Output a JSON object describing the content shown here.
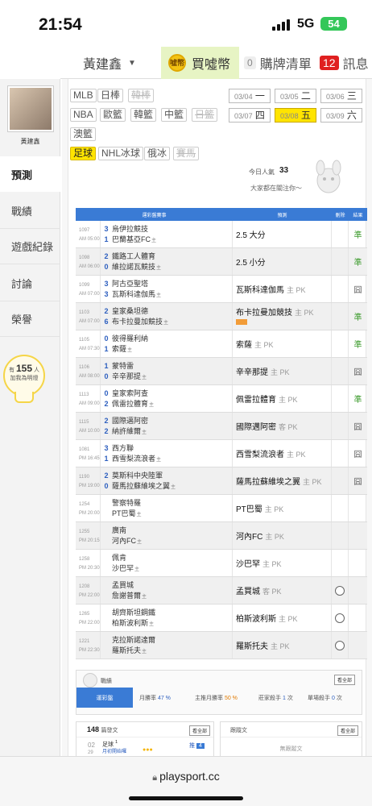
{
  "status_bar": {
    "time": "21:54",
    "network": "5G",
    "battery": "54"
  },
  "top_nav": {
    "user": "黃建鑫",
    "buy_label": "買噓幣",
    "coin_text": "噓幣",
    "bought_count": "0",
    "bought_label": "購牌清單",
    "msg_count": "12",
    "msg_label": "訊息"
  },
  "sidebar": {
    "name": "黃建鑫",
    "items": [
      "預測",
      "戰績",
      "遊戲紀錄",
      "討論",
      "榮譽"
    ],
    "people_count": "155",
    "people_unit": "人",
    "people_text": "加我為明燈",
    "people_prefix": "有"
  },
  "leagues": [
    {
      "label": "MLB",
      "state": "normal"
    },
    {
      "label": "日棒",
      "state": "normal"
    },
    {
      "label": "韓棒",
      "state": "disabled"
    },
    {
      "label": "NBA",
      "state": "normal"
    },
    {
      "label": "歐籃",
      "state": "normal"
    },
    {
      "label": "韓籃",
      "state": "normal"
    },
    {
      "label": "中籃",
      "state": "normal"
    },
    {
      "label": "日籃",
      "state": "disabled"
    },
    {
      "label": "澳籃",
      "state": "normal"
    },
    {
      "label": "足球",
      "state": "selected"
    },
    {
      "label": "NHL冰球",
      "state": "normal"
    },
    {
      "label": "俄冰",
      "state": "normal"
    },
    {
      "label": "賽馬",
      "state": "disabled"
    }
  ],
  "dates": [
    {
      "md": "03/04",
      "wd": "一"
    },
    {
      "md": "03/05",
      "wd": "二"
    },
    {
      "md": "03/06",
      "wd": "三"
    },
    {
      "md": "03/07",
      "wd": "四"
    },
    {
      "md": "03/08",
      "wd": "五",
      "selected": true
    },
    {
      "md": "03/09",
      "wd": "六"
    }
  ],
  "popularity": {
    "label": "今日人氣",
    "value": "33",
    "sub": "大家都在關注你～"
  },
  "table": {
    "headers": [
      "運彩盤賽事",
      "預測",
      "刪除",
      "結果"
    ],
    "rows": [
      {
        "id": "1097",
        "time": "AM 05:00",
        "s1": "3",
        "s2": "1",
        "t1": "烏伊拉競技",
        "t2": "巴蘭基亞FC",
        "t2tag": "主",
        "pred": "2.5 大分",
        "sub": "",
        "del": false,
        "res": "準"
      },
      {
        "id": "1098",
        "time": "AM 06:00",
        "s1": "2",
        "s2": "0",
        "t1": "鐵路工人體育",
        "t2": "維拉諾瓦競技",
        "t2tag": "主",
        "pred": "2.5 小分",
        "sub": "",
        "del": false,
        "res": "準"
      },
      {
        "id": "1099",
        "time": "AM 07:00",
        "s1": "3",
        "s2": "3",
        "t1": "阿古亞聖塔",
        "t2": "瓦斯科達伽馬",
        "t2tag": "主",
        "pred": "瓦斯科達伽馬",
        "sub": "主 PK",
        "del": false,
        "res": "囧"
      },
      {
        "id": "1103",
        "time": "AM 07:00",
        "s1": "2",
        "s2": "6",
        "t1": "皇家桑坦德",
        "t2": "布卡拉曼加競技",
        "t2tag": "主",
        "pred": "布卡拉曼加競技",
        "sub": "主 PK",
        "del": false,
        "res": "準",
        "tag": true
      },
      {
        "id": "1105",
        "time": "AM 07:30",
        "s1": "0",
        "s2": "1",
        "t1": "彼得羅利納",
        "t2": "索薩",
        "t2tag": "主",
        "pred": "索薩",
        "sub": "主 PK",
        "del": false,
        "res": "準"
      },
      {
        "id": "1106",
        "time": "AM 08:00",
        "s1": "1",
        "s2": "0",
        "t1": "蒙特雷",
        "t2": "辛辛那提",
        "t2tag": "主",
        "pred": "辛辛那提",
        "sub": "主 PK",
        "del": false,
        "res": "囧"
      },
      {
        "id": "1113",
        "time": "AM 09:00",
        "s1": "0",
        "s2": "2",
        "t1": "皇家索阿查",
        "t2": "佩雷拉體育",
        "t2tag": "主",
        "pred": "佩雷拉體育",
        "sub": "主 PK",
        "del": false,
        "res": "準"
      },
      {
        "id": "1115",
        "time": "AM 10:00",
        "s1": "2",
        "s2": "2",
        "t1": "國際邁阿密",
        "t2": "納許維爾",
        "t2tag": "主",
        "pred": "國際邁阿密",
        "sub": "客 PK",
        "del": false,
        "res": "囧"
      },
      {
        "id": "1081",
        "time": "PM 16:45",
        "s1": "3",
        "s2": "1",
        "t1": "西方聯",
        "t2": "西雪梨流浪者",
        "t2tag": "主",
        "pred": "西雪梨流浪者",
        "sub": "主 PK",
        "del": false,
        "res": "囧"
      },
      {
        "id": "1190",
        "time": "PM 19:00",
        "s1": "2",
        "s2": "0",
        "t1": "莫斯科中央陸軍",
        "t2": "薩馬拉蘇維埃之翼",
        "t2tag": "主",
        "pred": "薩馬拉蘇維埃之翼",
        "sub": "主 PK",
        "del": false,
        "res": "囧"
      },
      {
        "id": "1254",
        "time": "PM 20:00",
        "s1": "",
        "s2": "",
        "t1": "警察特羅",
        "t2": "PT巴蜀",
        "t2tag": "主",
        "pred": "PT巴蜀",
        "sub": "主 PK",
        "del": false,
        "res": ""
      },
      {
        "id": "1255",
        "time": "PM 20:15",
        "s1": "",
        "s2": "",
        "t1": "廣南",
        "t2": "河內FC",
        "t2tag": "主",
        "pred": "河內FC",
        "sub": "主 PK",
        "del": false,
        "res": ""
      },
      {
        "id": "1258",
        "time": "PM 20:30",
        "s1": "",
        "s2": "",
        "t1": "佩肯",
        "t2": "沙巴罕",
        "t2tag": "主",
        "pred": "沙巴罕",
        "sub": "主 PK",
        "del": false,
        "res": ""
      },
      {
        "id": "1208",
        "time": "PM 22:00",
        "s1": "",
        "s2": "",
        "t1": "孟買城",
        "t2": "詹謝普爾",
        "t2tag": "主",
        "pred": "孟買城",
        "sub": "客 PK",
        "del": true,
        "res": ""
      },
      {
        "id": "1265",
        "time": "PM 22:00",
        "s1": "",
        "s2": "",
        "t1": "胡齊斯坦鋼鐵",
        "t2": "柏斯波利斯",
        "t2tag": "主",
        "pred": "柏斯波利斯",
        "sub": "主 PK",
        "del": true,
        "res": ""
      },
      {
        "id": "1221",
        "time": "PM 22:30",
        "s1": "",
        "s2": "",
        "t1": "克拉斯諾達爾",
        "t2": "羅斯托夫",
        "t2tag": "主",
        "pred": "羅斯托夫",
        "sub": "主 PK",
        "del": true,
        "res": ""
      }
    ]
  },
  "record": {
    "title": "戰績",
    "all_label": "看全部",
    "tab": "運彩盤",
    "month_rate_label": "月勝率",
    "month_rate": "47 %",
    "main_rate_label": "主推月勝率",
    "main_rate": "50 %",
    "killer_label": "莊家殺手",
    "killer": "1",
    "killer_unit": "次",
    "single_label": "單場殺手",
    "single": "0",
    "single_unit": "次"
  },
  "bottom": {
    "left_count": "148",
    "left_label": "篇發文",
    "left_btn": "看全部",
    "post_date": "02",
    "post_day": "29",
    "post_title": "足球",
    "post_num": "1",
    "post_text": "月初開始囉",
    "post_tag_label": "推",
    "post_tag": "4",
    "right_title": "跟蹤文",
    "right_btn": "看全部",
    "right_empty": "無跟蹤文"
  },
  "url": "playsport.cc"
}
